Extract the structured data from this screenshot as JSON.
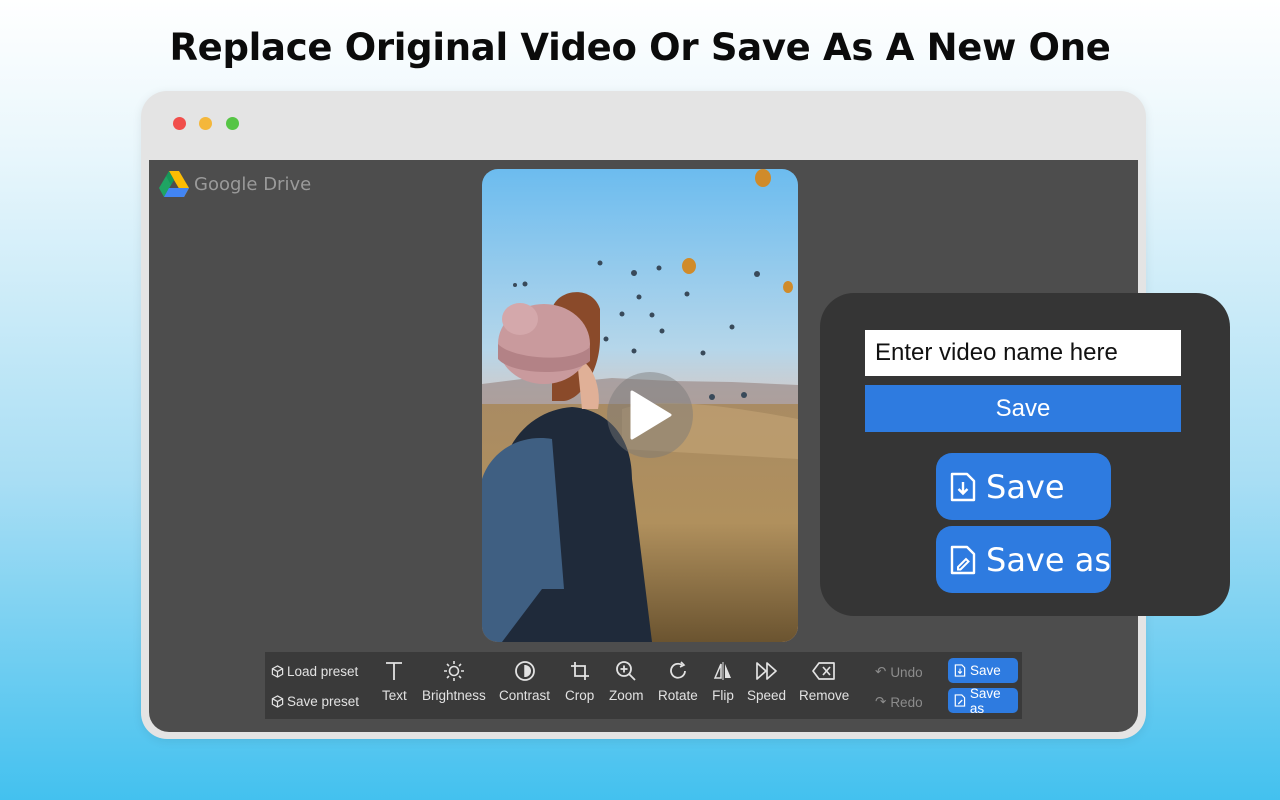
{
  "headline": "Replace Original Video Or Save As A New One",
  "app": {
    "brand": "Google Drive",
    "icons": {
      "logo": "google-drive-logo-icon",
      "play": "play-icon"
    }
  },
  "toolbar": {
    "load_preset": "Load preset",
    "save_preset": "Save preset",
    "tools": [
      {
        "label": "Text",
        "icon": "text-icon"
      },
      {
        "label": "Brightness",
        "icon": "brightness-icon"
      },
      {
        "label": "Contrast",
        "icon": "contrast-icon"
      },
      {
        "label": "Crop",
        "icon": "crop-icon"
      },
      {
        "label": "Zoom",
        "icon": "zoom-in-icon"
      },
      {
        "label": "Rotate",
        "icon": "rotate-icon"
      },
      {
        "label": "Flip",
        "icon": "flip-icon"
      },
      {
        "label": "Speed",
        "icon": "fast-forward-icon"
      },
      {
        "label": "Remove",
        "icon": "backspace-icon"
      }
    ],
    "undo": "Undo",
    "redo": "Redo",
    "save": "Save",
    "save_as": "Save as"
  },
  "panel": {
    "name_value": "Enter video name here",
    "save_label": "Save",
    "big_save": "Save",
    "big_save_as": "Save as"
  },
  "colors": {
    "accent": "#2e7be0",
    "app_background": "#4d4d4d",
    "toolbar_background": "#3a3a3a",
    "panel_background": "#353535",
    "window_frame": "#e4e4e4"
  }
}
